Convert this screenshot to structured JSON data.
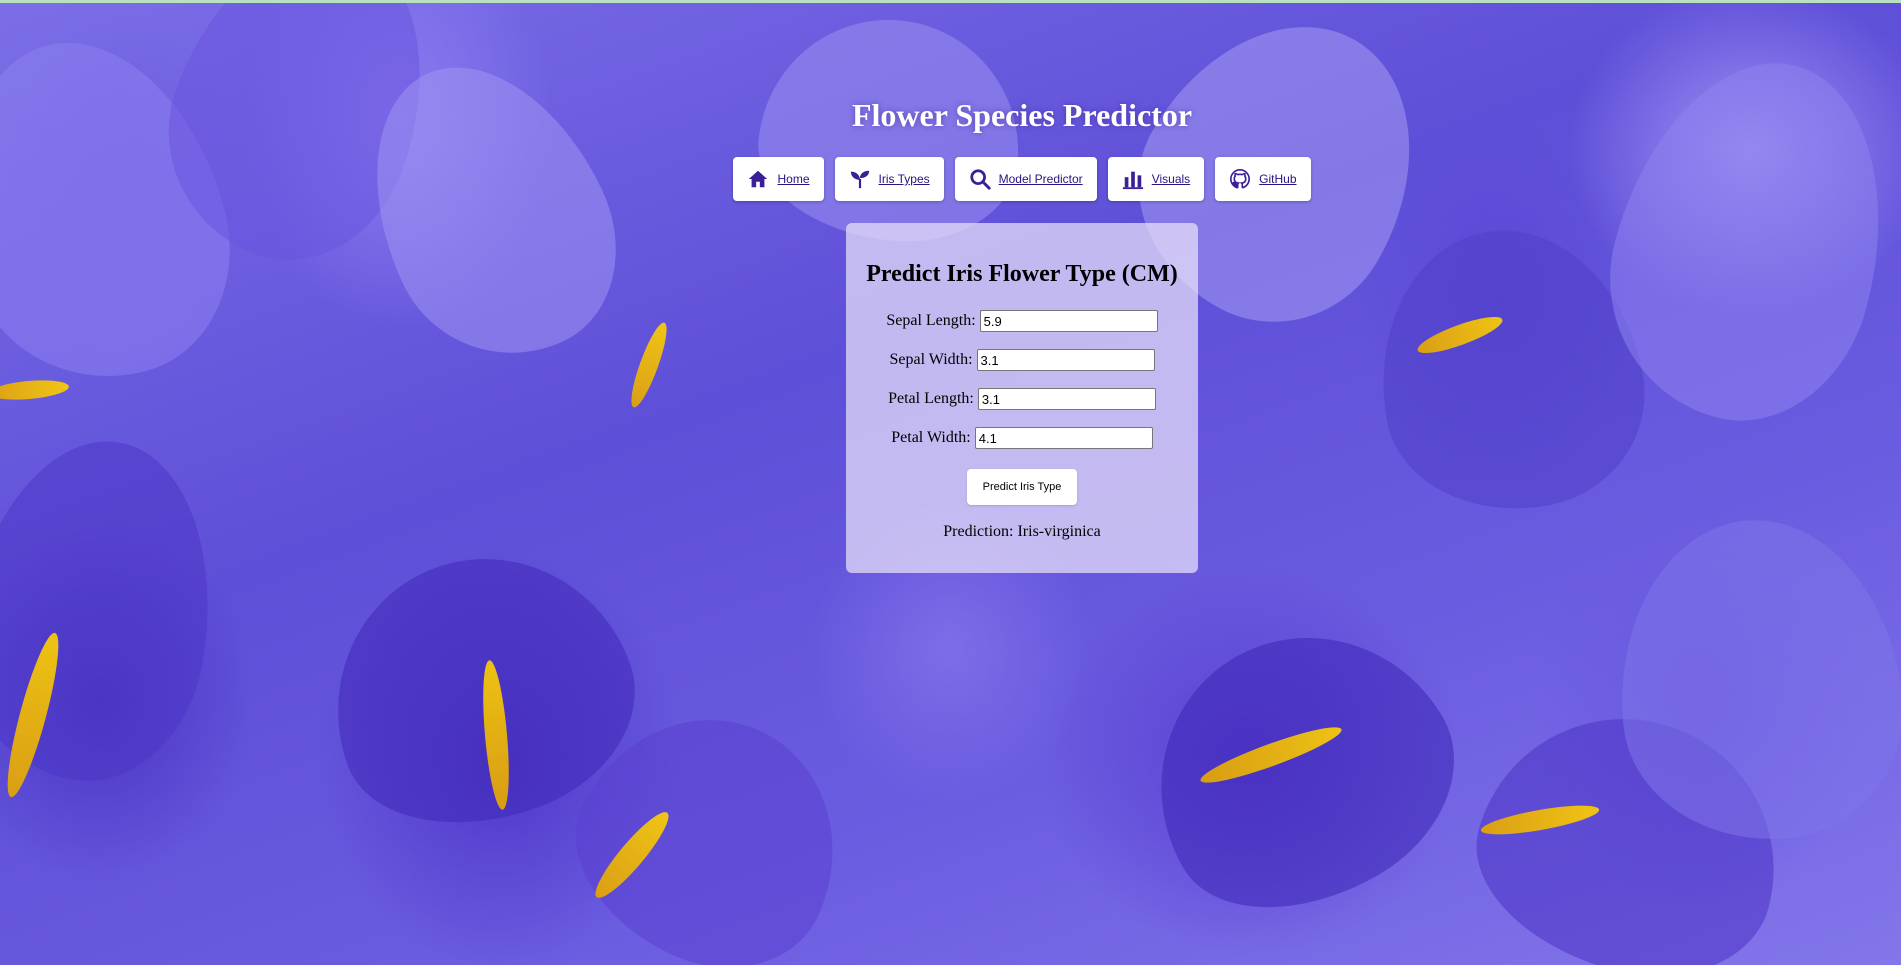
{
  "page": {
    "title": "Flower Species Predictor",
    "accent_color": "#3a1f99",
    "background_theme": "purple iris flowers photo"
  },
  "nav": {
    "items": [
      {
        "label": "Home",
        "icon": "home-icon"
      },
      {
        "label": "Iris Types",
        "icon": "sprout-icon"
      },
      {
        "label": "Model Predictor",
        "icon": "search-icon"
      },
      {
        "label": "Visuals",
        "icon": "bar-chart-icon"
      },
      {
        "label": "GitHub",
        "icon": "github-icon"
      }
    ]
  },
  "form": {
    "title": "Predict Iris Flower Type (CM)",
    "fields": [
      {
        "label": "Sepal Length:",
        "value": "5.9"
      },
      {
        "label": "Sepal Width:",
        "value": "3.1"
      },
      {
        "label": "Petal Length:",
        "value": "3.1"
      },
      {
        "label": "Petal Width:",
        "value": "4.1"
      }
    ],
    "submit_label": "Predict Iris Type",
    "prediction_text": "Prediction: Iris-virginica"
  }
}
